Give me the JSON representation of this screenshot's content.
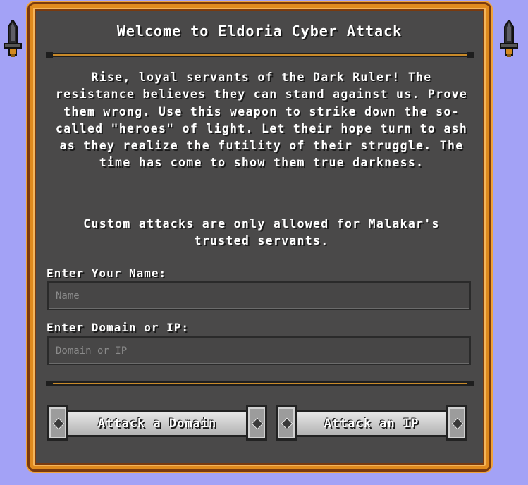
{
  "page": {
    "title": "Welcome to Eldoria Cyber Attack",
    "story": "Rise, loyal servants of the Dark Ruler! The resistance believes they can stand against us. Prove them wrong. Use this weapon to strike down the so-called \"heroes\" of light. Let their hope turn to ash as they realize the futility of their struggle. The time has come to show them true darkness.",
    "notice": "Custom attacks are only allowed for Malakar's trusted servants."
  },
  "form": {
    "name_label": "Enter Your Name:",
    "name_placeholder": "Name",
    "name_value": "",
    "domain_label": "Enter Domain or IP:",
    "domain_placeholder": "Domain or IP",
    "domain_value": ""
  },
  "buttons": {
    "attack_domain": "Attack a Domain",
    "attack_ip": "Attack an IP"
  },
  "icons": {
    "left_torch": "torch-icon",
    "right_torch": "torch-icon",
    "button_gem": "gem-icon"
  },
  "colors": {
    "background": "#a3a2f6",
    "panel": "#4a4949",
    "frame_gold": "#e08a1e",
    "frame_dark": "#7a3a0e",
    "button_silver": "#c8c8c8"
  }
}
